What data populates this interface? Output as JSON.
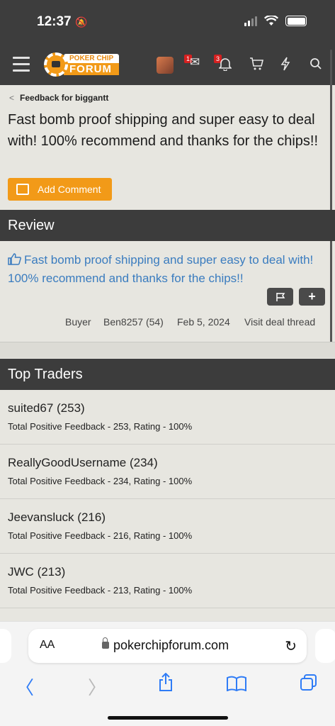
{
  "status": {
    "time": "12:37"
  },
  "nav": {
    "logo_top": "POKER CHIP",
    "logo_bottom": "FORUM",
    "messages_badge": "1",
    "alerts_badge": "3"
  },
  "breadcrumb": {
    "label": "Feedback for biggantt"
  },
  "page": {
    "title": "Fast bomb proof shipping and super easy to deal with! 100% recommend and thanks for the chips!!",
    "add_comment": "Add Comment"
  },
  "review": {
    "header": "Review",
    "text": "Fast bomb proof shipping and super easy to deal with! 100% recommend and thanks for the chips!!",
    "role": "Buyer",
    "user": "Ben8257 (54)",
    "date": "Feb 5, 2024",
    "link": "Visit deal thread"
  },
  "top_traders": {
    "header": "Top Traders",
    "items": [
      {
        "name": "suited67",
        "count": "(253)",
        "stats": "Total Positive Feedback - 253, Rating - 100%"
      },
      {
        "name": "ReallyGoodUsername",
        "count": "(234)",
        "stats": "Total Positive Feedback - 234, Rating - 100%"
      },
      {
        "name": "Jeevansluck",
        "count": "(216)",
        "stats": "Total Positive Feedback - 216, Rating - 100%"
      },
      {
        "name": "JWC",
        "count": "(213)",
        "stats": "Total Positive Feedback - 213, Rating - 100%"
      }
    ]
  },
  "safari": {
    "aa": "AA",
    "url": "pokerchipforum.com"
  },
  "colors": {
    "accent": "#f29a18",
    "header_bg": "#3c3c3c",
    "link": "#3a7cbf"
  }
}
